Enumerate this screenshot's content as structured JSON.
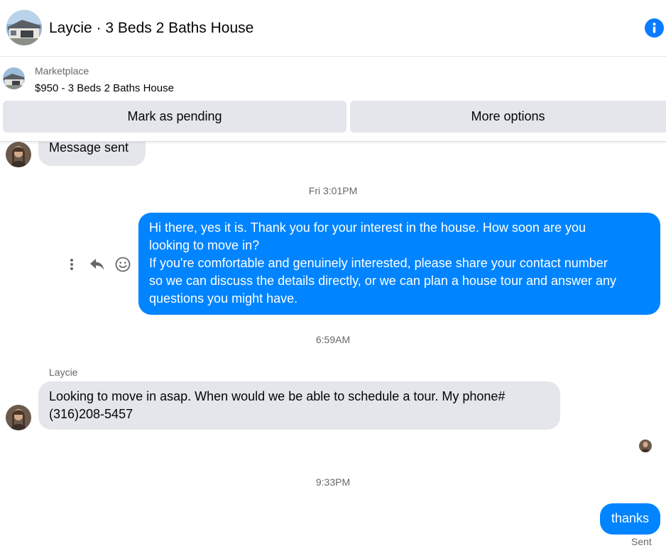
{
  "header": {
    "title": "Laycie · 3 Beds 2 Baths House",
    "info_icon": "info-icon",
    "accent_color": "#0a7cff"
  },
  "listing": {
    "source": "Marketplace",
    "title": "$950 - 3 Beds 2 Baths House"
  },
  "actions": {
    "mark_pending": "Mark as pending",
    "more_options": "More options"
  },
  "thread": {
    "previous_message": "Message sent",
    "timestamp_1": "Fri 3:01PM",
    "outgoing_1_lines": [
      "Hi there, yes it is. Thank you for your interest in the house. How soon are you",
      "looking to move in?",
      "If you're comfortable and genuinely interested, please share your contact number",
      "so we can discuss the details directly, or we can plan a house tour and answer any",
      "questions you might have."
    ],
    "timestamp_2": "6:59AM",
    "sender_name": "Laycie",
    "incoming_lines": [
      "Looking to move in asap. When would we be able to schedule a tour. My phone#",
      "(316)208-5457"
    ],
    "timestamp_3": "9:33PM",
    "outgoing_2": "thanks",
    "sent_status": "Sent"
  },
  "colors": {
    "outgoing_bubble": "#0084ff",
    "incoming_bubble": "#e4e6eb",
    "button_bg": "#e4e6eb"
  }
}
